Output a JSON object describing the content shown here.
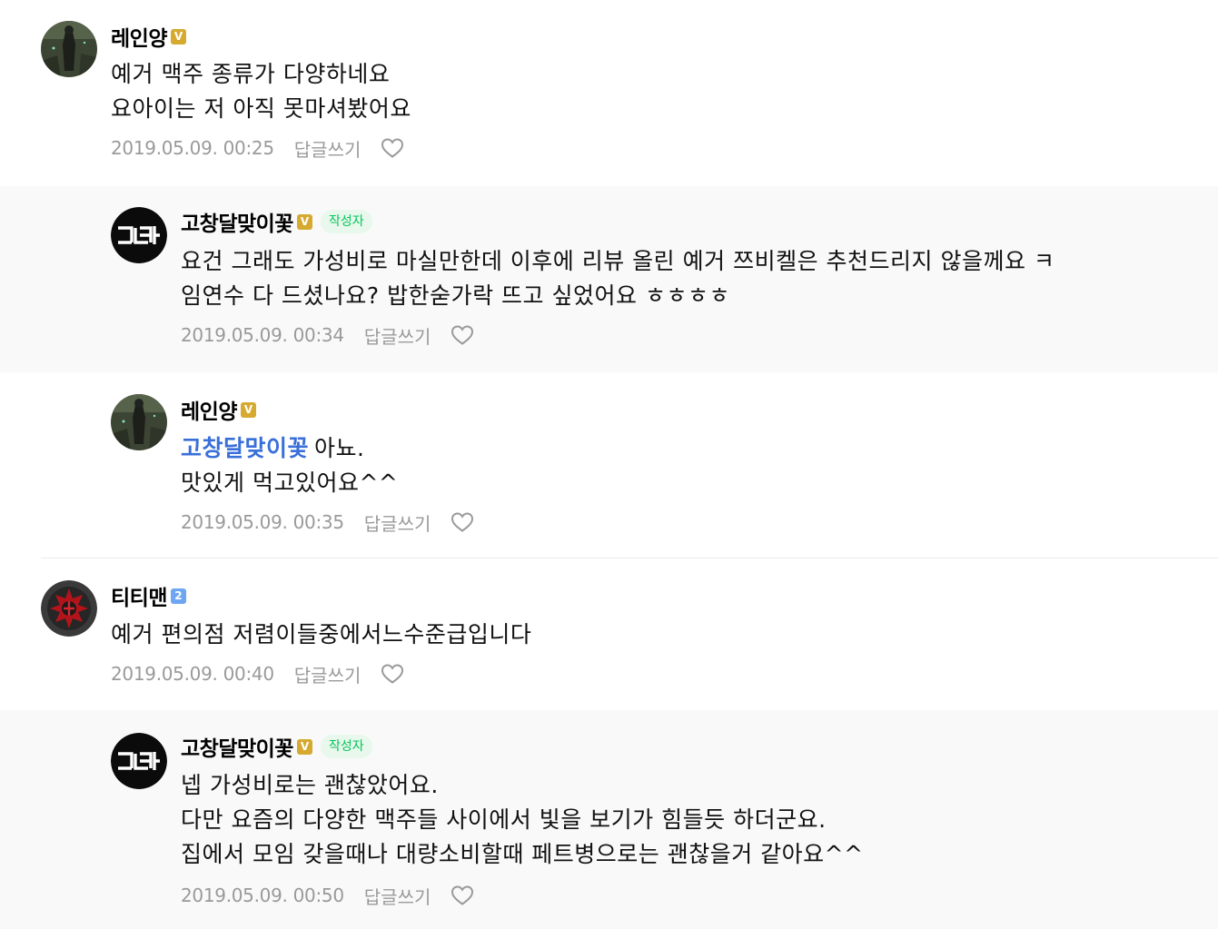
{
  "comments": [
    {
      "nickname": "레인양",
      "level": "V",
      "author_badge": "",
      "mention": "",
      "lines": [
        "예거 맥주 종류가 다양하네요",
        "요아이는 저 아직 못마셔봤어요"
      ],
      "date": "2019.05.09. 00:25",
      "reply_label": "답글쓰기"
    },
    {
      "nickname": "고창달맞이꽃",
      "level": "V",
      "author_badge": "작성자",
      "mention": "",
      "lines": [
        "요건 그래도 가성비로 마실만한데 이후에 리뷰 올린 예거 쯔비켈은 추천드리지 않을께요 ㅋ",
        "임연수 다 드셨나요? 밥한숟가락 뜨고 싶었어요 ㅎㅎㅎㅎ"
      ],
      "date": "2019.05.09. 00:34",
      "reply_label": "답글쓰기"
    },
    {
      "nickname": "레인양",
      "level": "V",
      "author_badge": "",
      "mention": "고창달맞이꽃",
      "lines": [
        "아뇨.",
        "맛있게 먹고있어요^^"
      ],
      "date": "2019.05.09. 00:35",
      "reply_label": "답글쓰기"
    },
    {
      "nickname": "티티맨",
      "level": "2",
      "author_badge": "",
      "mention": "",
      "lines": [
        "예거 편의점 저렴이들중에서느수준급입니다"
      ],
      "date": "2019.05.09. 00:40",
      "reply_label": "답글쓰기"
    },
    {
      "nickname": "고창달맞이꽃",
      "level": "V",
      "author_badge": "작성자",
      "mention": "",
      "lines": [
        "넵 가성비로는 괜찮았어요.",
        "다만 요즘의 다양한 맥주들 사이에서 빛을 보기가 힘들듯 하더군요.",
        "집에서 모임 갖을때나 대량소비할때 페트병으로는 괜찮을거 같아요^^"
      ],
      "date": "2019.05.09. 00:50",
      "reply_label": "답글쓰기"
    }
  ],
  "colors": {
    "reply_background": "#f9f9f9",
    "meta_text": "#9a9a9a",
    "mention": "#3a6fd9",
    "author_badge_text": "#03c75a",
    "author_badge_bg": "#e8f8ec",
    "level_gold": "#d6a930",
    "level_blue": "#6fa6f2"
  },
  "icons": {
    "like": "heart-outline-icon",
    "avatar_author": "ghd-logo-icon"
  }
}
